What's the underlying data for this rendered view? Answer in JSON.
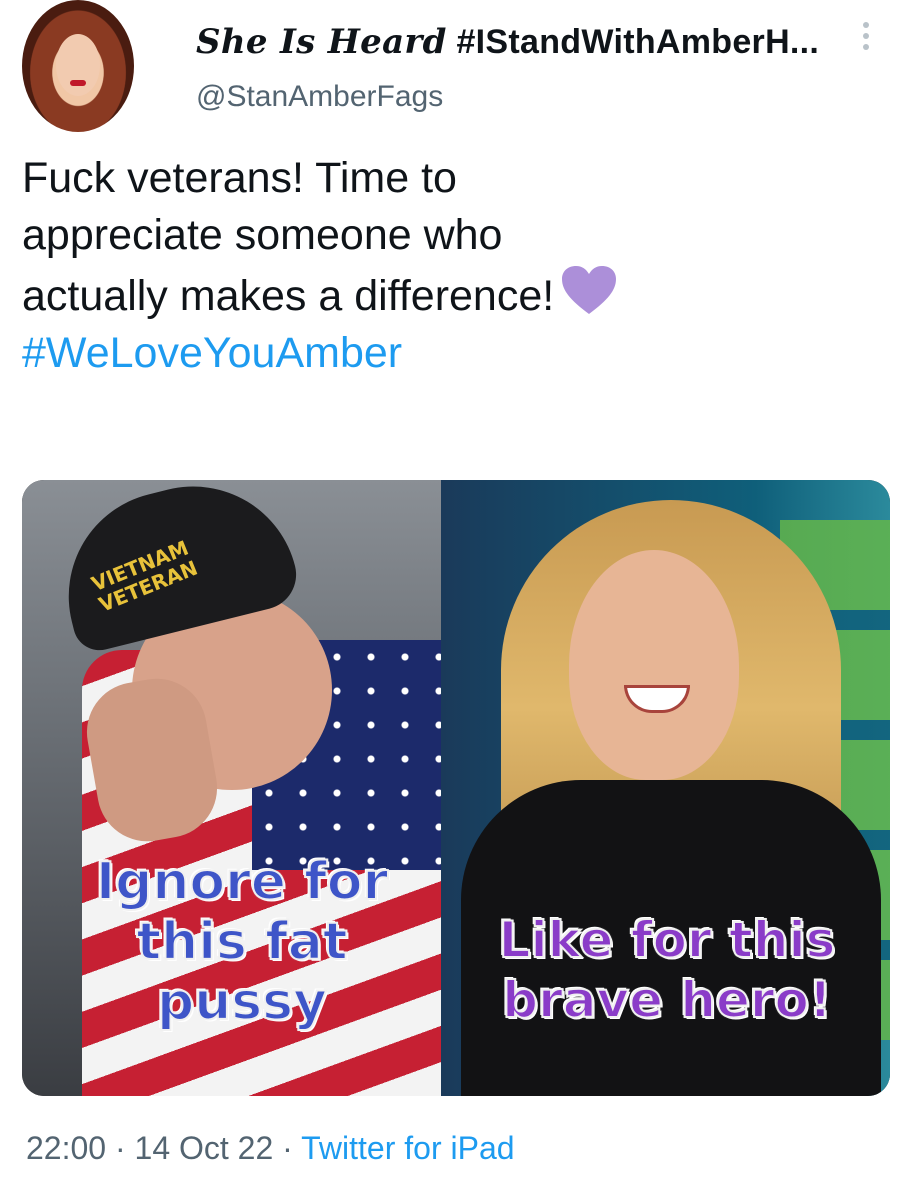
{
  "author": {
    "display_name_script": "She Is Heard",
    "display_name_rest": "#IStandWithAmberH...",
    "handle": "@StanAmberFags"
  },
  "tweet": {
    "lines": [
      "Fuck veterans! Time to",
      "appreciate someone who",
      "actually makes a difference!"
    ],
    "emoji": "purple-heart",
    "hashtag": "#WeLoveYouAmber"
  },
  "media": {
    "left_cap_text_line1": "VIETNAM",
    "left_cap_text_line2": "VETERAN",
    "left_caption_lines": [
      "Ignore for",
      "this fat",
      "pussy"
    ],
    "right_caption_lines": [
      "Like for this",
      "brave hero!"
    ]
  },
  "meta": {
    "time": "22:00",
    "date": "14 Oct 22",
    "source": "Twitter for iPad",
    "separator": " · "
  },
  "colors": {
    "text": "#0f1419",
    "secondary": "#536471",
    "link": "#1d9bf0",
    "heart": "#ac8fd9"
  },
  "icons": [
    "more-vertical-icon",
    "purple-heart-icon"
  ]
}
